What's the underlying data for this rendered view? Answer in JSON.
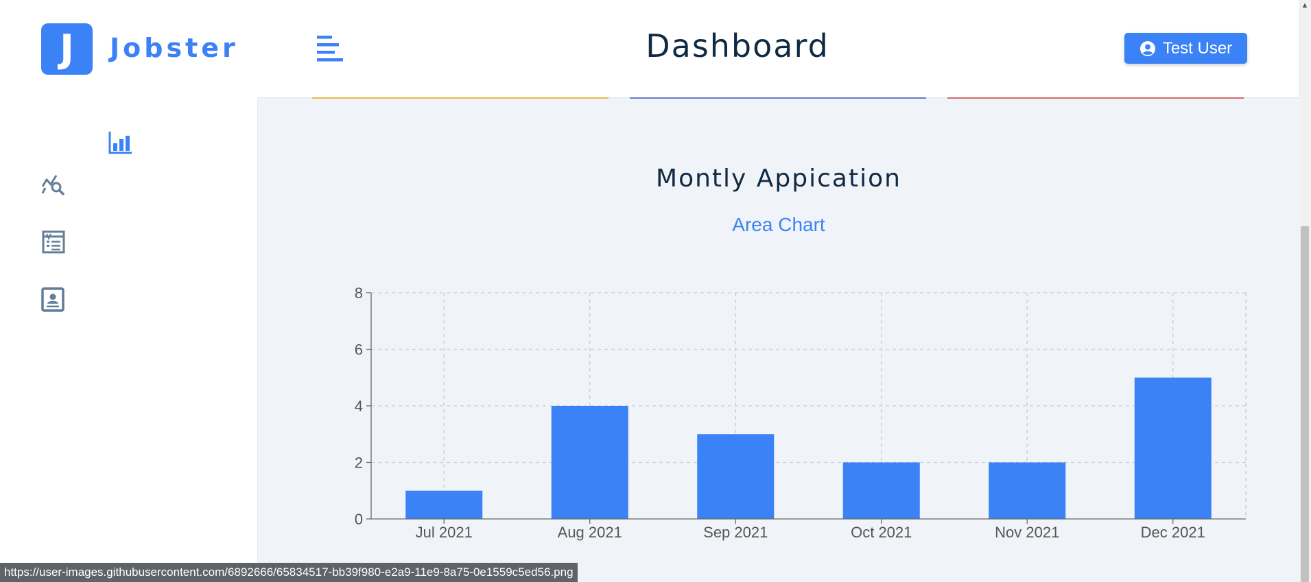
{
  "brand": {
    "initial": "J",
    "name": "Jobster"
  },
  "header": {
    "title": "Dashboard",
    "user_label": "Test User"
  },
  "sidebar": {
    "items": [
      {
        "icon": "bar-chart-icon"
      },
      {
        "icon": "query-stats-icon"
      },
      {
        "icon": "list-form-icon"
      },
      {
        "icon": "profile-card-icon"
      }
    ]
  },
  "chart_section": {
    "title": "Montly Appication",
    "toggle_label": "Area Chart"
  },
  "colors": {
    "accent": "#3b82f6",
    "background": "#f0f4f8",
    "text": "#102a43"
  },
  "chart_data": {
    "type": "bar",
    "categories": [
      "Jul 2021",
      "Aug 2021",
      "Sep 2021",
      "Oct 2021",
      "Nov 2021",
      "Dec 2021"
    ],
    "values": [
      1,
      4,
      3,
      2,
      2,
      5
    ],
    "ylim": [
      0,
      8
    ],
    "yticks": [
      0,
      2,
      4,
      6,
      8
    ],
    "grid": true
  },
  "status_bar": {
    "url": "https://user-images.githubusercontent.com/6892666/65834517-bb39f980-e2a9-11e9-8a75-0e1559c5ed56.png"
  }
}
